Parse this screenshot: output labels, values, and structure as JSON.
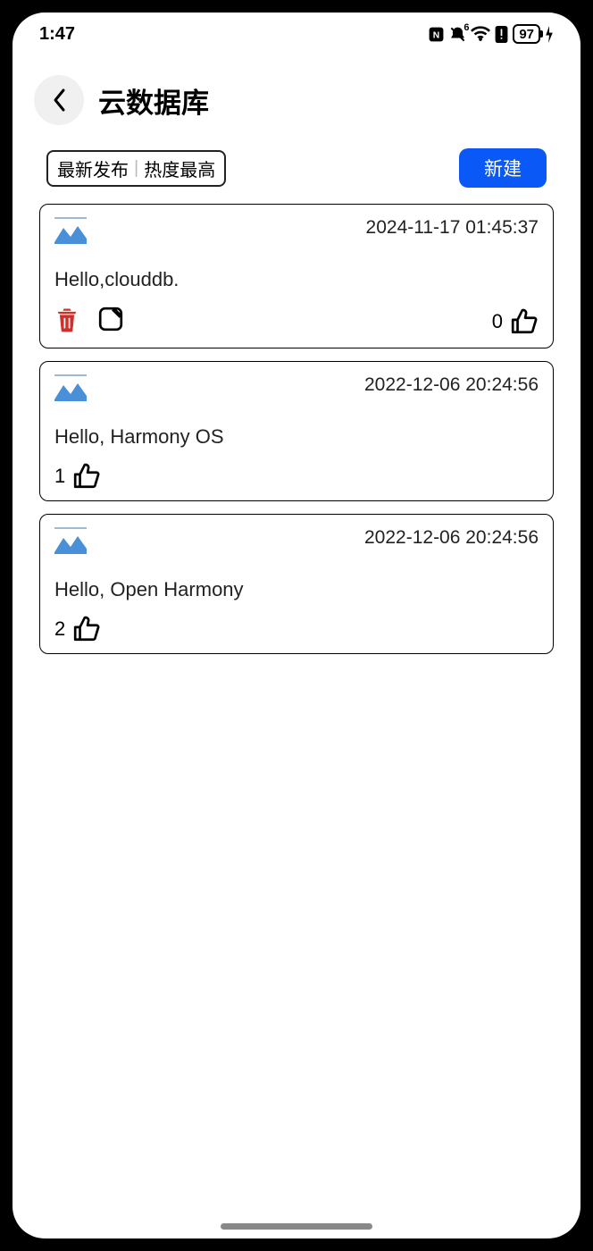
{
  "statusbar": {
    "time": "1:47",
    "wifi_superscript": "6",
    "battery_level": "97"
  },
  "header": {
    "title": "云数据库"
  },
  "toolbar": {
    "sort_newest": "最新发布",
    "sort_hottest": "热度最高",
    "new_label": "新建"
  },
  "records": [
    {
      "timestamp": "2024-11-17 01:45:37",
      "content": "Hello,clouddb.",
      "like_count": "0",
      "owned": true
    },
    {
      "timestamp": "2022-12-06 20:24:56",
      "content": "Hello, Harmony OS",
      "like_count": "1",
      "owned": false
    },
    {
      "timestamp": "2022-12-06 20:24:56",
      "content": "Hello, Open Harmony",
      "like_count": "2",
      "owned": false
    }
  ]
}
